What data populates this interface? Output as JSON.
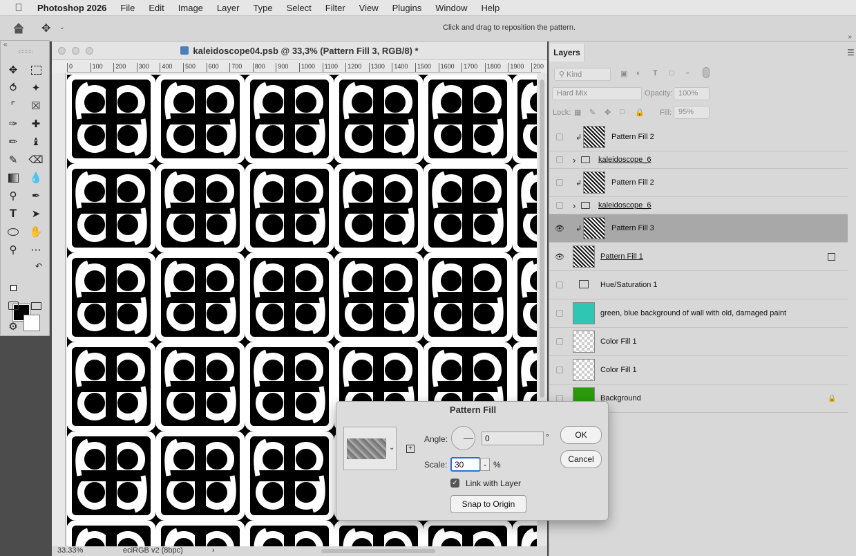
{
  "menubar": {
    "app_name": "Photoshop 2026",
    "items": [
      "File",
      "Edit",
      "Image",
      "Layer",
      "Type",
      "Select",
      "Filter",
      "View",
      "Plugins",
      "Window",
      "Help"
    ]
  },
  "options_bar": {
    "hint": "Click and drag to reposition the pattern."
  },
  "document": {
    "title": "kaleidoscope04.psb @ 33,3% (Pattern Fill 3, RGB/8) *",
    "ruler_ticks": [
      "0",
      "100",
      "200",
      "300",
      "400",
      "500",
      "600",
      "700",
      "800",
      "900",
      "1000",
      "1100",
      "1200",
      "1300",
      "1400",
      "1500",
      "1600",
      "1700",
      "1800",
      "1900",
      "200"
    ],
    "zoom": "33.33%",
    "color_profile": "eciRGB v2 (8bpc)",
    "status_arrow": "›"
  },
  "layers_panel": {
    "tab": "Layers",
    "kind_filter": "Kind",
    "blend_mode": "Hard Mix",
    "opacity_label": "Opacity:",
    "opacity_value": "100%",
    "lock_label": "Lock:",
    "fill_label": "Fill:",
    "fill_value": "95%",
    "layers": [
      {
        "name": "Pattern Fill 2",
        "visible": false,
        "clipped": true,
        "kind": "pattern",
        "underlined": false
      },
      {
        "name": "kaleidoscope_6",
        "visible": false,
        "kind": "group",
        "underlined": true
      },
      {
        "name": "Pattern Fill 2",
        "visible": false,
        "clipped": true,
        "kind": "pattern",
        "underlined": false
      },
      {
        "name": "kaleidoscope_6",
        "visible": false,
        "kind": "group",
        "underlined": true
      },
      {
        "name": "Pattern Fill 3",
        "visible": true,
        "clipped": true,
        "kind": "pattern",
        "selected": true,
        "underlined": false
      },
      {
        "name": "Pattern Fill 1",
        "visible": true,
        "kind": "pattern",
        "underlined": true
      },
      {
        "name": "Hue/Saturation 1",
        "visible": false,
        "kind": "adjustment",
        "underlined": false
      },
      {
        "name": "green, blue background of wall with old, damaged paint",
        "visible": false,
        "kind": "smart",
        "underlined": false
      },
      {
        "name": "Color Fill 1",
        "visible": false,
        "kind": "colorfill",
        "underlined": false
      },
      {
        "name": "Color Fill 1",
        "visible": false,
        "kind": "colorfill",
        "underlined": false
      },
      {
        "name": "Background",
        "visible": false,
        "kind": "background",
        "locked": true,
        "underlined": false
      }
    ]
  },
  "pattern_fill_dialog": {
    "title": "Pattern Fill",
    "angle_label": "Angle:",
    "angle_value": "0",
    "angle_unit": "°",
    "scale_label": "Scale:",
    "scale_value": "30",
    "scale_unit": "%",
    "link_with_layer_label": "Link with Layer",
    "link_with_layer_checked": true,
    "snap_to_origin_label": "Snap to Origin",
    "ok_label": "OK",
    "cancel_label": "Cancel"
  },
  "colors": {
    "accent": "#2e6fd6",
    "foreground_swatch": "#000000",
    "background_swatch": "#ffffff",
    "smart_layer_thumb": "#2fc7b4",
    "background_layer_thumb": "#2c9a0c"
  }
}
